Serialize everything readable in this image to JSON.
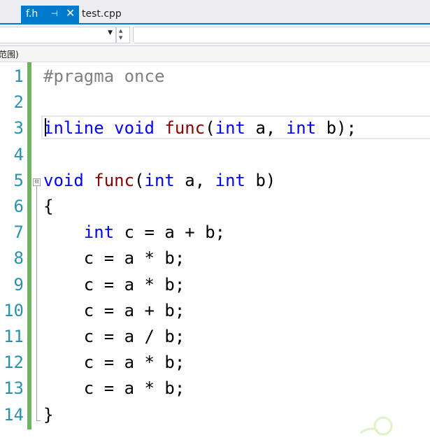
{
  "tabs": [
    {
      "label": "f.h",
      "active": true,
      "pin_icon": "pin-icon",
      "close_icon": "close-icon"
    },
    {
      "label": "test.cpp",
      "active": false
    }
  ],
  "navbar": {
    "dropdown_icon": "chevron-down-icon",
    "spin_up_icon": "spin-up-icon",
    "spin_down_icon": "spin-down-icon"
  },
  "scope": {
    "text": "范围)"
  },
  "colors": {
    "accent": "#007acc",
    "line_numbers": "#2b91af",
    "keyword": "#0000ff",
    "preprocessor": "#808080",
    "function": "#880000",
    "change_bar": "#57a64a"
  },
  "editor": {
    "line_numbers": [
      "1",
      "2",
      "3",
      "4",
      "5",
      "6",
      "7",
      "8",
      "9",
      "10",
      "11",
      "12",
      "13",
      "14"
    ],
    "lines": [
      {
        "num": "1",
        "tokens": [
          {
            "t": "#pragma",
            "c": "pp"
          },
          {
            "t": " ",
            "c": ""
          },
          {
            "t": "once",
            "c": "pp"
          }
        ]
      },
      {
        "num": "2",
        "tokens": []
      },
      {
        "num": "3",
        "tokens": [
          {
            "t": "inline",
            "c": "kw"
          },
          {
            "t": " ",
            "c": ""
          },
          {
            "t": "void",
            "c": "kw"
          },
          {
            "t": " ",
            "c": ""
          },
          {
            "t": "func",
            "c": "fn"
          },
          {
            "t": "(",
            "c": ""
          },
          {
            "t": "int",
            "c": "kw"
          },
          {
            "t": " a, ",
            "c": ""
          },
          {
            "t": "int",
            "c": "kw"
          },
          {
            "t": " b);",
            "c": ""
          }
        ]
      },
      {
        "num": "4",
        "tokens": []
      },
      {
        "num": "5",
        "tokens": [
          {
            "t": "void",
            "c": "kw"
          },
          {
            "t": " ",
            "c": ""
          },
          {
            "t": "func",
            "c": "fn"
          },
          {
            "t": "(",
            "c": ""
          },
          {
            "t": "int",
            "c": "kw"
          },
          {
            "t": " a, ",
            "c": ""
          },
          {
            "t": "int",
            "c": "kw"
          },
          {
            "t": " b)",
            "c": ""
          }
        ]
      },
      {
        "num": "6",
        "tokens": [
          {
            "t": "{",
            "c": ""
          }
        ]
      },
      {
        "num": "7",
        "tokens": [
          {
            "t": "    ",
            "c": ""
          },
          {
            "t": "int",
            "c": "kw"
          },
          {
            "t": " c = a + b;",
            "c": ""
          }
        ]
      },
      {
        "num": "8",
        "tokens": [
          {
            "t": "    c = a * b;",
            "c": ""
          }
        ]
      },
      {
        "num": "9",
        "tokens": [
          {
            "t": "    c = a * b;",
            "c": ""
          }
        ]
      },
      {
        "num": "10",
        "tokens": [
          {
            "t": "    c = a + b;",
            "c": ""
          }
        ]
      },
      {
        "num": "11",
        "tokens": [
          {
            "t": "    c = a / b;",
            "c": ""
          }
        ]
      },
      {
        "num": "12",
        "tokens": [
          {
            "t": "    c = a * b;",
            "c": ""
          }
        ]
      },
      {
        "num": "13",
        "tokens": [
          {
            "t": "    c = a * b;",
            "c": ""
          }
        ]
      },
      {
        "num": "14",
        "tokens": [
          {
            "t": "}",
            "c": ""
          }
        ]
      }
    ],
    "outline_toggle": "⊟",
    "current_line": 3
  }
}
